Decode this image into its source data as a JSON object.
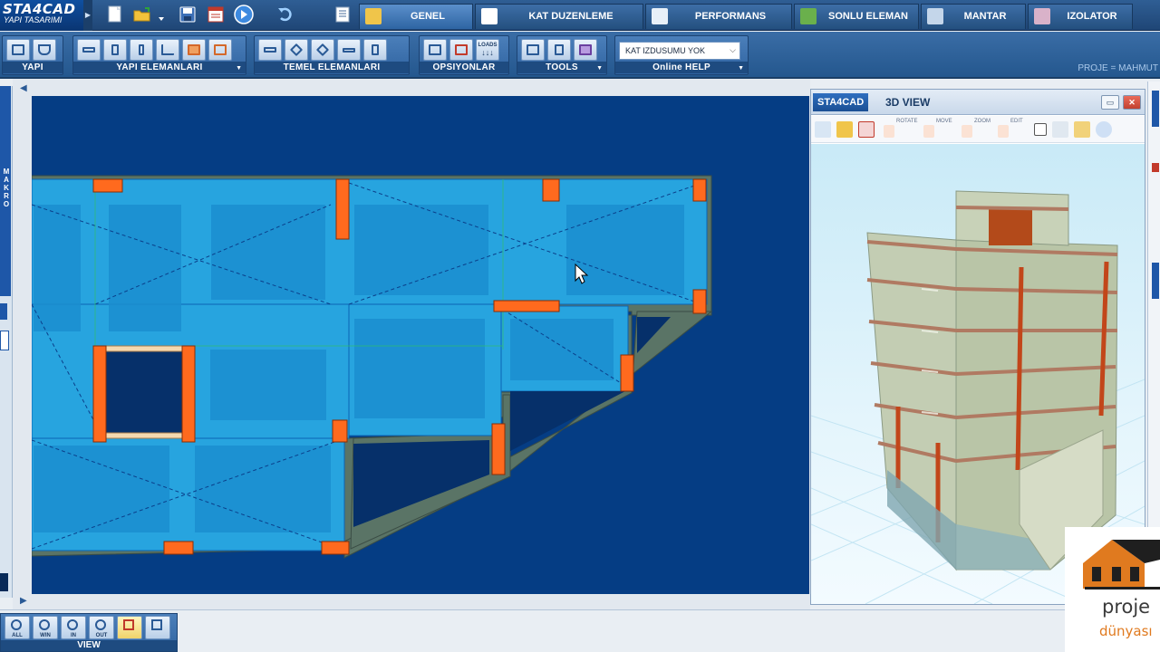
{
  "brand": {
    "title": "STA4CAD",
    "subtitle": "YAPI TASARIMI"
  },
  "tabs": [
    {
      "label": "GENEL",
      "icon": "home-icon"
    },
    {
      "label": "KAT DUZENLEME",
      "icon": "floor-grid-icon"
    },
    {
      "label": "PERFORMANS",
      "icon": "performance-chart-icon"
    },
    {
      "label": "SONLU ELEMAN",
      "icon": "finite-element-icon"
    },
    {
      "label": "MANTAR",
      "icon": "mushroom-slab-icon"
    },
    {
      "label": "IZOLATOR",
      "icon": "isolator-icon"
    }
  ],
  "ribbon": {
    "groups": [
      {
        "label": "YAPI"
      },
      {
        "label": "YAPI  ELEMANLARI"
      },
      {
        "label": "TEMEL  ELEMANLARI"
      },
      {
        "label": "OPSIYONLAR"
      },
      {
        "label": "TOOLS"
      },
      {
        "label": "Online HELP"
      }
    ],
    "opsiyonlar_loads_label": "LOADS",
    "dropdown_value": "KAT IZDUSUMU YOK",
    "project_label": "PROJE = MAHMUT"
  },
  "left_panel": {
    "makro_label": "MAKRO"
  },
  "view3d": {
    "brand": "STA4CAD",
    "title": "3D VIEW",
    "toolbar_labels": {
      "rotate": "ROTATE",
      "move": "MOVE",
      "zoom": "ZOOM",
      "edit": "EDIT"
    }
  },
  "view_group": {
    "label": "VIEW",
    "buttons": [
      {
        "caption": "ALL"
      },
      {
        "caption": "WIN"
      },
      {
        "caption": "IN"
      },
      {
        "caption": "OUT"
      },
      {
        "caption": ""
      },
      {
        "caption": ""
      }
    ]
  },
  "watermark": {
    "line1": "proje",
    "line2": "dünyası"
  },
  "colors": {
    "canvas_bg": "#053d84",
    "slab": "#2aa6e0",
    "column": "#ff6a1e",
    "beam_gray": "#5d7a6e"
  }
}
